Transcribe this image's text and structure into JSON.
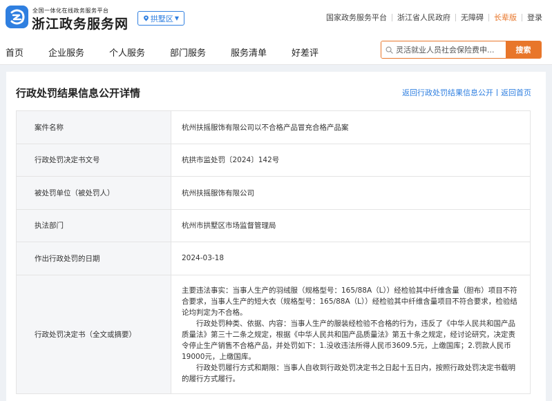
{
  "header": {
    "platform_tagline": "全国一体化在线政务服务平台",
    "site_name": "浙江政务服务网",
    "region": "拱墅区",
    "links": [
      "国家政务服务平台",
      "浙江省人民政府",
      "无障碍",
      "长辈版",
      "登录"
    ]
  },
  "nav": {
    "items": [
      "首页",
      "企业服务",
      "个人服务",
      "部门服务",
      "服务清单",
      "好差评"
    ],
    "search_placeholder": "灵活就业人员社会保险费申...",
    "search_button": "搜索"
  },
  "page": {
    "title": "行政处罚结果信息公开详情",
    "back_links": [
      "返回行政处罚结果信息公开",
      "返回首页"
    ]
  },
  "details": [
    {
      "label": "案件名称",
      "value": "杭州扶摇服饰有限公司以不合格产品冒充合格产品案"
    },
    {
      "label": "行政处罚决定书文号",
      "value": "杭拱市监处罚〔2024〕142号"
    },
    {
      "label": "被处罚单位（被处罚人）",
      "value": "杭州扶摇服饰有限公司"
    },
    {
      "label": "执法部门",
      "value": "杭州市拱墅区市场监督管理局"
    },
    {
      "label": "作出行政处罚的日期",
      "value": "2024-03-18"
    }
  ],
  "decision": {
    "label": "行政处罚决定书（全文或摘要）",
    "paragraphs": [
      "主要违法事实：当事人生产的羽绒服（规格型号：165/88A（L））经检验其中纤维含量（胆布）项目不符合要求，当事人生产的短大衣（规格型号：165/88A（L））经检验其中纤维含量项目不符合要求，检验结论均判定为不合格。",
      "行政处罚种类、依据、内容：当事人生产的服装经检验不合格的行为，违反了《中华人民共和国产品质量法》第三十二条之规定，根据《中华人民共和国产品质量法》第五十条之规定，经讨论研究，决定责令停止生产销售不合格产品，并处罚如下：1.没收违法所得人民币3609.5元，上缴国库；2.罚款人民币19000元，上缴国库。",
      "行政处罚履行方式和期限：当事人自收到行政处罚决定书之日起十五日内，按照行政处罚决定书载明的履行方式履行。"
    ]
  },
  "colors": {
    "accent_blue": "#2f7fe0",
    "accent_orange": "#e8762a"
  }
}
